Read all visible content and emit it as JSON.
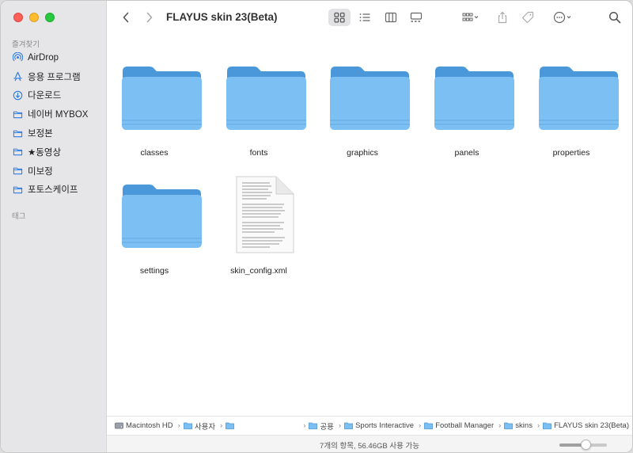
{
  "window": {
    "title": "FLAYUS skin 23(Beta)"
  },
  "sidebar": {
    "favorites_header": "즐겨찾기",
    "tags_header": "태그",
    "items": [
      {
        "label": "AirDrop",
        "icon": "airdrop-icon"
      },
      {
        "label": "응용 프로그램",
        "icon": "applications-icon"
      },
      {
        "label": "다운로드",
        "icon": "downloads-icon"
      },
      {
        "label": "네이버 MYBOX",
        "icon": "folder-icon"
      },
      {
        "label": "보정본",
        "icon": "folder-icon"
      },
      {
        "label": "★동영상",
        "icon": "folder-icon"
      },
      {
        "label": "미보정",
        "icon": "folder-icon"
      },
      {
        "label": "포토스케이프",
        "icon": "folder-icon"
      }
    ]
  },
  "toolbar": {
    "icons": [
      "back-icon",
      "forward-icon",
      "icon-view-icon",
      "list-view-icon",
      "column-view-icon",
      "gallery-view-icon",
      "group-icon",
      "share-icon",
      "tag-icon",
      "more-actions-icon",
      "search-icon"
    ]
  },
  "files": [
    {
      "name": "classes",
      "kind": "folder"
    },
    {
      "name": "fonts",
      "kind": "folder"
    },
    {
      "name": "graphics",
      "kind": "folder"
    },
    {
      "name": "panels",
      "kind": "folder"
    },
    {
      "name": "properties",
      "kind": "folder"
    },
    {
      "name": "settings",
      "kind": "folder"
    },
    {
      "name": "skin_config.xml",
      "kind": "document"
    }
  ],
  "pathbar": {
    "crumbs": [
      {
        "label": "Macintosh HD",
        "icon": "disk-icon"
      },
      {
        "label": "사용자",
        "icon": "folder-icon"
      },
      {
        "label": "",
        "icon": "folder-icon"
      },
      {
        "label": "공용",
        "icon": "folder-icon"
      },
      {
        "label": "Sports Interactive",
        "icon": "folder-icon"
      },
      {
        "label": "Football Manager",
        "icon": "folder-icon"
      },
      {
        "label": "skins",
        "icon": "folder-icon"
      },
      {
        "label": "FLAYUS skin 23(Beta)",
        "icon": "folder-icon"
      }
    ]
  },
  "status": {
    "text": "7개의 항목, 56.46GB 사용 가능",
    "zoom_level": 0.55
  },
  "colors": {
    "folder_front": "#7cc0f3",
    "folder_back": "#4a97d9",
    "accent": "#2c7be5"
  }
}
